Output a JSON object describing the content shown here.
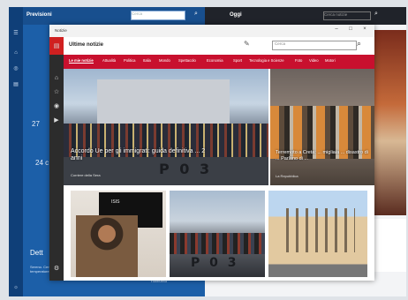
{
  "weather_app": {
    "title": "Previsioni",
    "search_placeholder": "Cerca",
    "temperature": "27",
    "day_temp": "24 c",
    "details_heading": "Dett",
    "details_text": "Sereno. Cerca... caldo e parlando venti ... temperature stagionale ...",
    "bottom_text": "Tramonto"
  },
  "oggi_app": {
    "title": "Oggi",
    "search_placeholder": "Cerca notizie"
  },
  "window": {
    "title": "Notizie",
    "controls": [
      "–",
      "□",
      "×"
    ]
  },
  "app": {
    "title": "Ultime notizie",
    "search_placeholder": "Cerca",
    "tabs": [
      "Le mie notizie",
      "Attualità",
      "Politica",
      "Italia",
      "Mondo",
      "Spettacolo",
      "Economia",
      "Sport",
      "Tecnologia e Scienze",
      "Foto",
      "Video",
      "Motori"
    ]
  },
  "hero": {
    "caption": "Accordo Ue per gli immigrati: guida definitiva ... 2 anni",
    "source": "Corriere della Sera",
    "hull_text": "P 0 3"
  },
  "side_story": {
    "caption": "Terremoto a Creta: ... migliaia ... disastro di ... Parlano di ... ",
    "source": "La Repubblica"
  },
  "cards": [
    {
      "overlay": "ISIS"
    },
    {
      "hull_text": "P 0 3"
    },
    {}
  ],
  "colors": {
    "brand_red": "#c8102e",
    "weather_blue": "#1c5fa8",
    "nav_dark": "#2c2c2c"
  }
}
